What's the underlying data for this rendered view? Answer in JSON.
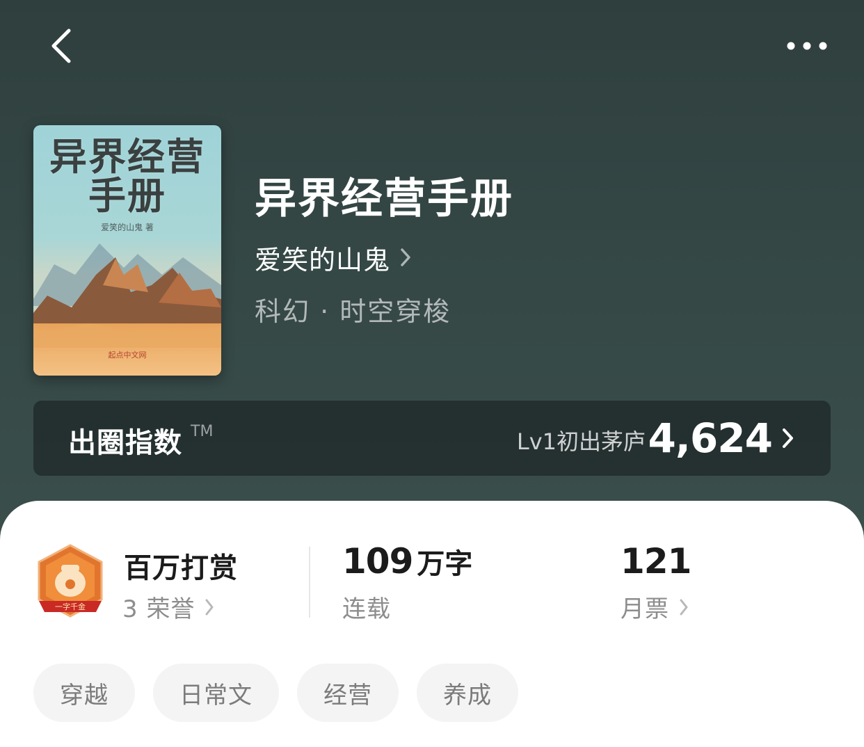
{
  "nav": {
    "back_icon": "chevron-left-icon",
    "more_icon": "more-dots-icon"
  },
  "book": {
    "cover_title": "异界经营手册",
    "cover_author": "爱笑的山鬼 著",
    "cover_publisher": "起点中文网",
    "title": "异界经营手册",
    "author": "爱笑的山鬼",
    "genre": "科幻 · 时空穿梭"
  },
  "index": {
    "label": "出圈指数",
    "tm": "TM",
    "level": "Lv1初出茅庐",
    "value": "4,624"
  },
  "stats": {
    "badge_text": "一字千金",
    "reward_title": "百万打赏",
    "reward_sub": "3 荣誉",
    "words_number": "109",
    "words_unit": "万字",
    "words_sub": "连载",
    "votes_number": "121",
    "votes_sub": "月票"
  },
  "tags": [
    "穿越",
    "日常文",
    "经营",
    "养成"
  ],
  "colors": {
    "hero_bg": "#344745",
    "badge_orange": "#e2752d",
    "badge_red": "#c92a24"
  }
}
